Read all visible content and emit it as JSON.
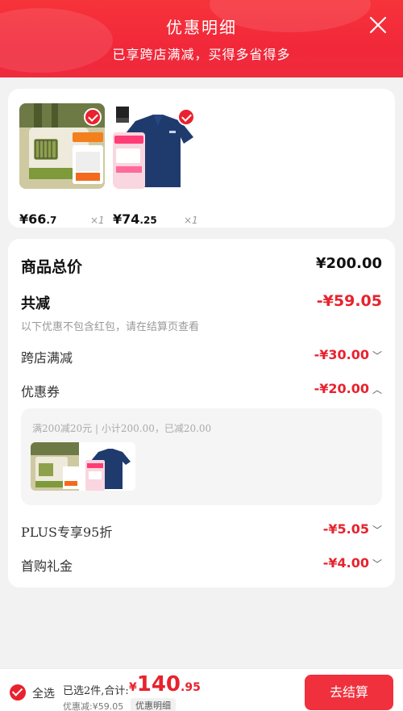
{
  "header": {
    "title": "优惠明细",
    "subtitle": "已享跨店满减，买得多省得多"
  },
  "products": [
    {
      "price_int": "¥66",
      "price_dec": ".7",
      "qty": "×1"
    },
    {
      "price_int": "¥74",
      "price_dec": ".25",
      "qty": "×1"
    }
  ],
  "summary": {
    "total_label": "商品总价",
    "total_value": "¥200.00",
    "reduce_label": "共减",
    "reduce_value": "-¥59.05",
    "note": "以下优惠不包含红包，请在结算页查看",
    "items": [
      {
        "label": "跨店满减",
        "value": "-¥30.00"
      },
      {
        "label": "优惠券",
        "value": "-¥20.00"
      },
      {
        "label": "PLUS专享95折",
        "value": "-¥5.05"
      },
      {
        "label": "首购礼金",
        "value": "-¥4.00"
      }
    ],
    "coupon_detail": "满200减20元 | 小计200.00，已减20.00"
  },
  "bottom": {
    "select_all": "全选",
    "selected": "已选2件,合计:",
    "price_cur": "¥",
    "price_int": "140",
    "price_dec": ".95",
    "discount": "优惠减:¥59.05",
    "detail_tag": "优惠明细",
    "checkout": "去结算"
  },
  "colors": {
    "accent": "#e8222e",
    "header": "#f1283a"
  }
}
